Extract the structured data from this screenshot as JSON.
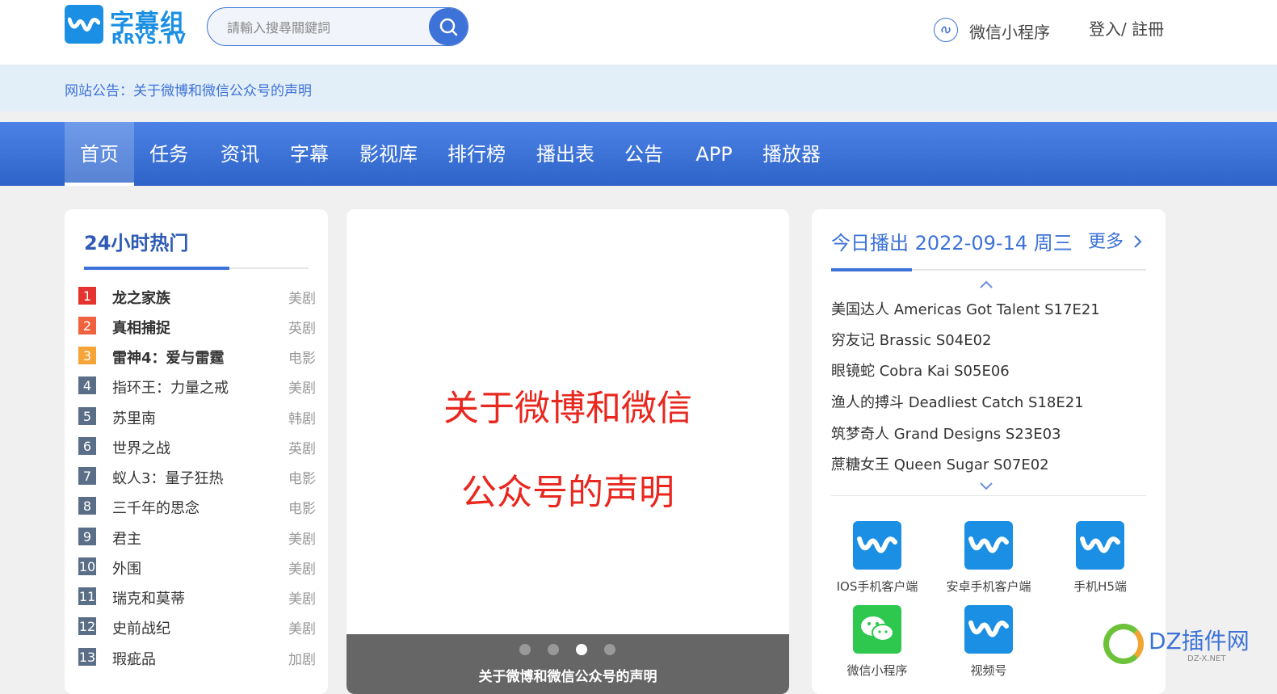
{
  "header": {
    "logo_cn": "字幕组",
    "logo_en": "RRYS.TV",
    "search_placeholder": "請輸入搜尋關鍵詞",
    "miniapp_label": "微信小程序",
    "login_label": "登入/ 註冊"
  },
  "notice": {
    "text": "网站公告：关于微博和微信公众号的声明"
  },
  "nav": {
    "items": [
      {
        "label": "首页",
        "active": true
      },
      {
        "label": "任务"
      },
      {
        "label": "资讯"
      },
      {
        "label": "字幕"
      },
      {
        "label": "影视库"
      },
      {
        "label": "排行榜"
      },
      {
        "label": "播出表"
      },
      {
        "label": "公告"
      },
      {
        "label": "APP"
      },
      {
        "label": "播放器"
      }
    ]
  },
  "hot": {
    "title": "24小时热门",
    "items": [
      {
        "rank": "1",
        "name": "龙之家族",
        "type": "美剧"
      },
      {
        "rank": "2",
        "name": "真相捕捉",
        "type": "英剧"
      },
      {
        "rank": "3",
        "name": "雷神4：爱与雷霆",
        "type": "电影"
      },
      {
        "rank": "4",
        "name": "指环王：力量之戒",
        "type": "美剧"
      },
      {
        "rank": "5",
        "name": "苏里南",
        "type": "韩剧"
      },
      {
        "rank": "6",
        "name": "世界之战",
        "type": "英剧"
      },
      {
        "rank": "7",
        "name": "蚁人3：量子狂热",
        "type": "电影"
      },
      {
        "rank": "8",
        "name": "三千年的思念",
        "type": "电影"
      },
      {
        "rank": "9",
        "name": "君主",
        "type": "美剧"
      },
      {
        "rank": "10",
        "name": "外围",
        "type": "美剧"
      },
      {
        "rank": "11",
        "name": "瑞克和莫蒂",
        "type": "美剧"
      },
      {
        "rank": "12",
        "name": "史前战纪",
        "type": "美剧"
      },
      {
        "rank": "13",
        "name": "瑕疵品",
        "type": "加剧"
      }
    ]
  },
  "banner": {
    "line1": "关于微博和微信",
    "line2": "公众号的声明",
    "caption": "关于微博和微信公众号的声明",
    "active_slide": 3,
    "slide_count": 4
  },
  "today": {
    "title": "今日播出 2022-09-14 周三",
    "more": "更多",
    "episodes": [
      "美国达人 Americas Got Talent S17E21",
      "穷友记 Brassic S04E02",
      "眼镜蛇 Cobra Kai S05E06",
      "渔人的搏斗 Deadliest Catch S18E21",
      "筑梦奇人 Grand Designs S23E03",
      "蔗糖女王 Queen Sugar S07E02"
    ],
    "apps": [
      {
        "label": "IOS手机客户端",
        "icon": "rrys-logo-icon"
      },
      {
        "label": "安卓手机客户端",
        "icon": "rrys-logo-icon"
      },
      {
        "label": "手机H5端",
        "icon": "rrys-logo-icon"
      },
      {
        "label": "微信小程序",
        "icon": "wechat-icon"
      },
      {
        "label": "视频号",
        "icon": "rrys-logo-icon"
      }
    ]
  },
  "watermark": {
    "text": "DZ插件网",
    "sub": "DZ-X.NET"
  },
  "colors": {
    "brand": "#3d72d8",
    "logo": "#1a8fe3",
    "banner_text": "#e8281f",
    "notice_bg": "#e2eef8"
  }
}
